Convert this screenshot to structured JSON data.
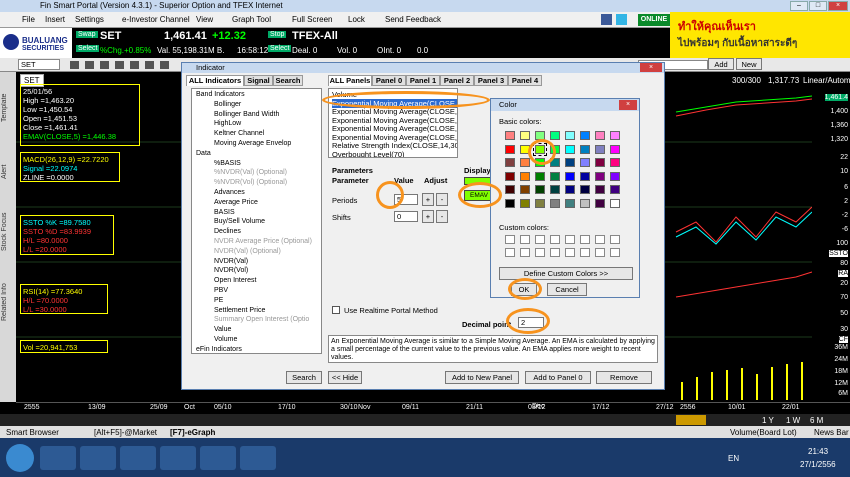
{
  "window": {
    "title": "Fin Smart Portal (Version 4.3.1) - Superior Option and TFEX Internet",
    "controls": [
      "–",
      "□",
      "×"
    ]
  },
  "menu": {
    "items": [
      "File",
      "Insert",
      "Settings",
      "e-Investor Channel",
      "View",
      "Graph Tool",
      "Full Screen",
      "Lock",
      "Send Feedback"
    ],
    "online": "ONLINE"
  },
  "ad": {
    "line1": "ทำให้คุณเห็นเรา",
    "line2": "ไปพร้อมๆ กับเนื้อหาสาระดีๆ"
  },
  "logo": {
    "name": "BUALUANG",
    "sub": "SECURITIES"
  },
  "quote": {
    "swap": "Swap",
    "select": "Select",
    "symbol": "SET",
    "price": "1,461.41",
    "change": "+12.32",
    "pct": "%Chg.+0.85%",
    "val": "Val. 55,198.31M B.",
    "time": "16:58:12",
    "stop": "Stop",
    "tfex": "TFEX-All",
    "deal": "Deal. 0",
    "vol": "Vol. 0",
    "oint": "OInt. 0",
    "zero": "0.0"
  },
  "toolbar": {
    "symbol": "SET",
    "add": "Add",
    "new": "New",
    "count": "300/300",
    "last": "1,317.73",
    "scale": "Linear/Autom"
  },
  "rail": {
    "tabs": [
      "Template",
      "Alert",
      "Stock Focus",
      "Related Info"
    ]
  },
  "chart": {
    "info": {
      "date": "25/01/56",
      "high": "High =1,463.20",
      "low": "Low =1,450.54",
      "open": "Open =1,451.53",
      "close": "Close =1,461.41",
      "ema": "EMAV(CLOSE,5) =1,446.38"
    },
    "macd": {
      "label": "MACD(26,12,9) =22.7220",
      "signal": "Signal =22.0974",
      "zero": "ZLINE =0.0000"
    },
    "ssto": {
      "k": "SSTO %K =89.7580",
      "d": "SSTO %D =83.9939",
      "h": "H/L =80.0000",
      "l": "L/L =20.0000"
    },
    "rsi": {
      "v": "RSI(14) =77.3640",
      "h": "H/L =70.0000",
      "l": "L/L =30.0000"
    },
    "vol": {
      "v": "Vol =20,941,753"
    },
    "right_scale": [
      "1,461.4",
      "1,400",
      "1,360",
      "1,320",
      "22",
      "10",
      "6",
      "2",
      "-2",
      "-6",
      "100",
      "SSTO",
      "80",
      "RA",
      "20",
      "70",
      "50",
      "30",
      "CF",
      "36M",
      "24M",
      "18M",
      "12M",
      "6M"
    ],
    "x_labels": [
      "2555",
      "13/09",
      "25/09",
      "Oct",
      "05/10",
      "17/10",
      "30/10",
      "Nov",
      "09/11",
      "21/11",
      "03/12",
      "Dec",
      "17/12",
      "27/12",
      "2556",
      "10/01",
      "22/01"
    ],
    "periods": [
      "1 Y",
      "1 W",
      "6 M"
    ]
  },
  "indicator_dialog": {
    "title": "Indicator",
    "tabs": [
      "ALL Indicators",
      "Signal",
      "Search"
    ],
    "tree": [
      {
        "t": "Band Indicators",
        "lvl": 0
      },
      {
        "t": "Bollinger",
        "lvl": 1
      },
      {
        "t": "Bollinger Band Width",
        "lvl": 1
      },
      {
        "t": "HighLow",
        "lvl": 1
      },
      {
        "t": "Keltner Channel",
        "lvl": 1
      },
      {
        "t": "Moving Average Envelop",
        "lvl": 1
      },
      {
        "t": "Data",
        "lvl": 0
      },
      {
        "t": "%BASIS",
        "lvl": 1
      },
      {
        "t": "%NVDR(Val) (Optional)",
        "lvl": 1,
        "dim": true
      },
      {
        "t": "%NVDR(Vol) (Optional)",
        "lvl": 1,
        "dim": true
      },
      {
        "t": "Advances",
        "lvl": 1
      },
      {
        "t": "Average Price",
        "lvl": 1
      },
      {
        "t": "BASIS",
        "lvl": 1
      },
      {
        "t": "Buy/Sell Volume",
        "lvl": 1
      },
      {
        "t": "Declines",
        "lvl": 1
      },
      {
        "t": "NVDR Average Price (Optional)",
        "lvl": 1,
        "dim": true
      },
      {
        "t": "NVDR(Val) (Optional)",
        "lvl": 1,
        "dim": true
      },
      {
        "t": "NVDR(Val)",
        "lvl": 1
      },
      {
        "t": "NVDR(Vol)",
        "lvl": 1
      },
      {
        "t": "Open Interest",
        "lvl": 1
      },
      {
        "t": "PBV",
        "lvl": 1
      },
      {
        "t": "PE",
        "lvl": 1
      },
      {
        "t": "Settlement Price",
        "lvl": 1
      },
      {
        "t": "Summary Open Interest (Optio",
        "lvl": 1,
        "dim": true
      },
      {
        "t": "Value",
        "lvl": 1
      },
      {
        "t": "Volume",
        "lvl": 1
      },
      {
        "t": "eFin Indicators",
        "lvl": 0
      }
    ],
    "search_btn": "Search",
    "panel_tabs": [
      "ALL Panels",
      "Panel 0",
      "Panel 1",
      "Panel 2",
      "Panel 3",
      "Panel 4"
    ],
    "panel_list": [
      "Volume",
      "Exponential Moving Average(CLOSE,5,0)",
      "Exponential Moving Average(CLOSE,5,0)",
      "Exponential Moving Average(CLOSE,14,0)",
      "Exponential Moving Average(CLOSE,14,0)",
      "Exponential Moving Average(CLOSE,14,0)",
      "Relative Strength Index(CLOSE,14,30,70)",
      "Overbought Level(70)"
    ],
    "params_title": "Parameters",
    "param_h": "Parameter",
    "value_h": "Value",
    "adjust_h": "Adjust",
    "display_h": "Display",
    "periods_lbl": "Periods",
    "periods_val": "5",
    "shifts_lbl": "Shifts",
    "shifts_val": "0",
    "plus": "+",
    "minus": "-",
    "swatch_label": "EMAV",
    "realtime": "Use Realtime Portal Method",
    "decimal_lbl": "Decimal point",
    "decimal_val": "2",
    "description": "An Exponential Moving Average is similar to a Simple Moving Average. An EMA is calculated by applying a small percentage of the current value to the previous value. An EMA applies more weight to recent values.",
    "hide": "<< Hide",
    "add_new": "Add to New Panel",
    "add_p0": "Add to Panel 0",
    "remove": "Remove"
  },
  "color_dialog": {
    "title": "Color",
    "basic": "Basic colors:",
    "custom": "Custom colors:",
    "define": "Define Custom Colors >>",
    "ok": "OK",
    "cancel": "Cancel",
    "colors": [
      "#ff8080",
      "#ffff80",
      "#80ff80",
      "#00ff80",
      "#80ffff",
      "#0080ff",
      "#ff80c0",
      "#ff80ff",
      "#ff0000",
      "#ffff00",
      "#80ff00",
      "#00ff40",
      "#00ffff",
      "#0080c0",
      "#8080c0",
      "#ff00ff",
      "#804040",
      "#ff8040",
      "#00ff00",
      "#008080",
      "#004080",
      "#8080ff",
      "#800040",
      "#ff0080",
      "#800000",
      "#ff8000",
      "#008000",
      "#008040",
      "#0000ff",
      "#0000a0",
      "#800080",
      "#8000ff",
      "#400000",
      "#804000",
      "#004000",
      "#004040",
      "#000080",
      "#000040",
      "#400040",
      "#400080",
      "#000000",
      "#808000",
      "#808040",
      "#808080",
      "#408080",
      "#c0c0c0",
      "#400040",
      "#ffffff"
    ],
    "selected_index": 10
  },
  "bottom": {
    "tabs": [
      "Smart Browser",
      "[Alt+F5]-@Market",
      "[F7]-eGraph"
    ],
    "right": "Volume(Board Lot)",
    "news": "News Bar"
  },
  "taskbar": {
    "lang": "EN",
    "time": "21:43",
    "date": "27/1/2556"
  }
}
